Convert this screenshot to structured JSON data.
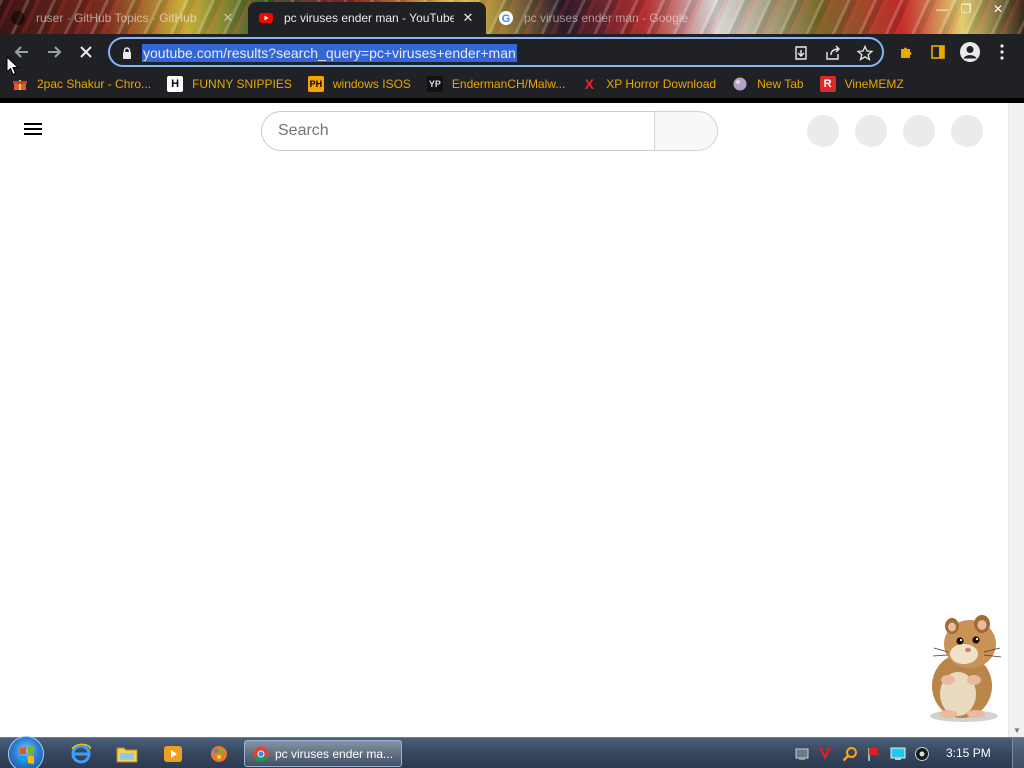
{
  "browser": {
    "tabs": [
      {
        "title": "ruser · GitHub Topics · GitHub",
        "close": "✕"
      },
      {
        "title": "pc viruses ender man - YouTube",
        "close": "✕"
      },
      {
        "title": "pc viruses ender man - Google",
        "close": ""
      }
    ],
    "window_controls": {
      "minimize": "—",
      "maximize": "❐",
      "close": "✕"
    },
    "address": "youtube.com/results?search_query=pc+viruses+ender+man",
    "bookmarks": [
      {
        "label": "2pac Shakur - Chro...",
        "icon": "gift-icon"
      },
      {
        "label": "FUNNY SNIPPIES",
        "icon": "H"
      },
      {
        "label": "windows ISOS",
        "icon": "PH"
      },
      {
        "label": "EndermanCH/Malw...",
        "icon": "YP"
      },
      {
        "label": "XP Horror Download",
        "icon": "X"
      },
      {
        "label": "New Tab",
        "icon": "globe-icon"
      },
      {
        "label": "VineMEMZ",
        "icon": "R"
      }
    ]
  },
  "youtube": {
    "search_placeholder": "Search"
  },
  "taskbar": {
    "active_window": "pc viruses ender ma...",
    "clock": "3:15 PM"
  },
  "colors": {
    "accent_blue": "#8ab4f8",
    "url_selection": "#3367d6",
    "bookmark_text": "#e8a800",
    "chrome_dark": "#202124"
  }
}
